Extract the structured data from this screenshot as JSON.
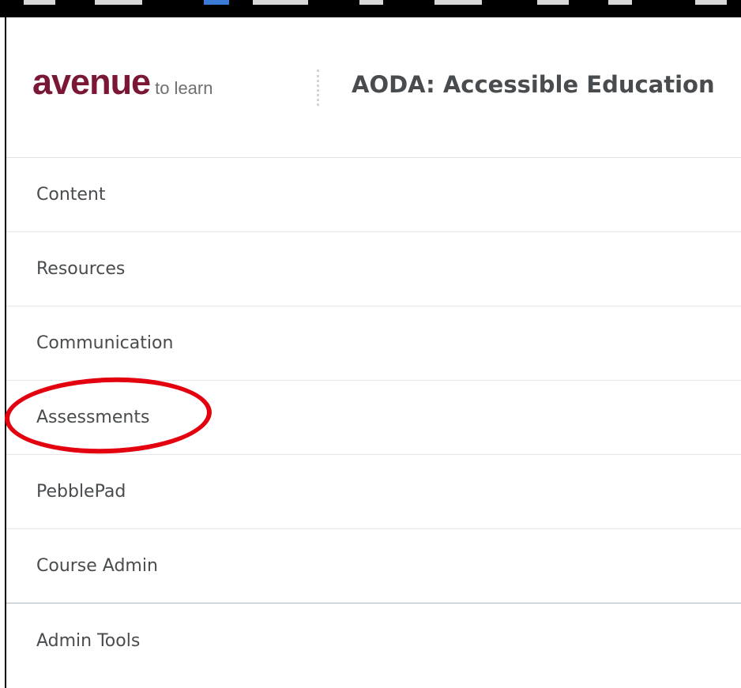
{
  "header": {
    "logo": {
      "main": "avenue",
      "sub": "to learn"
    },
    "course_title": "AODA: Accessible Education"
  },
  "nav": {
    "items": [
      {
        "label": "Content"
      },
      {
        "label": "Resources"
      },
      {
        "label": "Communication"
      },
      {
        "label": "Assessments",
        "highlighted": true
      },
      {
        "label": "PebblePad"
      },
      {
        "label": "Course Admin"
      },
      {
        "label": "Admin Tools"
      }
    ]
  },
  "annotation": {
    "target": "Assessments",
    "color": "#e3000f"
  },
  "colors": {
    "brand": "#7a1734",
    "text": "#494c4e",
    "annotation": "#e3000f"
  }
}
